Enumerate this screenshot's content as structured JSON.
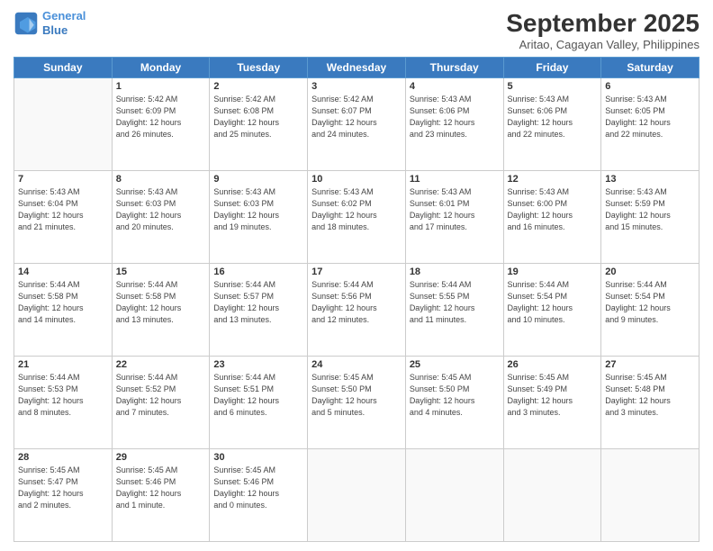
{
  "logo": {
    "line1": "General",
    "line2": "Blue"
  },
  "title": "September 2025",
  "subtitle": "Aritao, Cagayan Valley, Philippines",
  "weekdays": [
    "Sunday",
    "Monday",
    "Tuesday",
    "Wednesday",
    "Thursday",
    "Friday",
    "Saturday"
  ],
  "weeks": [
    [
      {
        "day": "",
        "info": ""
      },
      {
        "day": "1",
        "info": "Sunrise: 5:42 AM\nSunset: 6:09 PM\nDaylight: 12 hours\nand 26 minutes."
      },
      {
        "day": "2",
        "info": "Sunrise: 5:42 AM\nSunset: 6:08 PM\nDaylight: 12 hours\nand 25 minutes."
      },
      {
        "day": "3",
        "info": "Sunrise: 5:42 AM\nSunset: 6:07 PM\nDaylight: 12 hours\nand 24 minutes."
      },
      {
        "day": "4",
        "info": "Sunrise: 5:43 AM\nSunset: 6:06 PM\nDaylight: 12 hours\nand 23 minutes."
      },
      {
        "day": "5",
        "info": "Sunrise: 5:43 AM\nSunset: 6:06 PM\nDaylight: 12 hours\nand 22 minutes."
      },
      {
        "day": "6",
        "info": "Sunrise: 5:43 AM\nSunset: 6:05 PM\nDaylight: 12 hours\nand 22 minutes."
      }
    ],
    [
      {
        "day": "7",
        "info": "Sunrise: 5:43 AM\nSunset: 6:04 PM\nDaylight: 12 hours\nand 21 minutes."
      },
      {
        "day": "8",
        "info": "Sunrise: 5:43 AM\nSunset: 6:03 PM\nDaylight: 12 hours\nand 20 minutes."
      },
      {
        "day": "9",
        "info": "Sunrise: 5:43 AM\nSunset: 6:03 PM\nDaylight: 12 hours\nand 19 minutes."
      },
      {
        "day": "10",
        "info": "Sunrise: 5:43 AM\nSunset: 6:02 PM\nDaylight: 12 hours\nand 18 minutes."
      },
      {
        "day": "11",
        "info": "Sunrise: 5:43 AM\nSunset: 6:01 PM\nDaylight: 12 hours\nand 17 minutes."
      },
      {
        "day": "12",
        "info": "Sunrise: 5:43 AM\nSunset: 6:00 PM\nDaylight: 12 hours\nand 16 minutes."
      },
      {
        "day": "13",
        "info": "Sunrise: 5:43 AM\nSunset: 5:59 PM\nDaylight: 12 hours\nand 15 minutes."
      }
    ],
    [
      {
        "day": "14",
        "info": "Sunrise: 5:44 AM\nSunset: 5:58 PM\nDaylight: 12 hours\nand 14 minutes."
      },
      {
        "day": "15",
        "info": "Sunrise: 5:44 AM\nSunset: 5:58 PM\nDaylight: 12 hours\nand 13 minutes."
      },
      {
        "day": "16",
        "info": "Sunrise: 5:44 AM\nSunset: 5:57 PM\nDaylight: 12 hours\nand 13 minutes."
      },
      {
        "day": "17",
        "info": "Sunrise: 5:44 AM\nSunset: 5:56 PM\nDaylight: 12 hours\nand 12 minutes."
      },
      {
        "day": "18",
        "info": "Sunrise: 5:44 AM\nSunset: 5:55 PM\nDaylight: 12 hours\nand 11 minutes."
      },
      {
        "day": "19",
        "info": "Sunrise: 5:44 AM\nSunset: 5:54 PM\nDaylight: 12 hours\nand 10 minutes."
      },
      {
        "day": "20",
        "info": "Sunrise: 5:44 AM\nSunset: 5:54 PM\nDaylight: 12 hours\nand 9 minutes."
      }
    ],
    [
      {
        "day": "21",
        "info": "Sunrise: 5:44 AM\nSunset: 5:53 PM\nDaylight: 12 hours\nand 8 minutes."
      },
      {
        "day": "22",
        "info": "Sunrise: 5:44 AM\nSunset: 5:52 PM\nDaylight: 12 hours\nand 7 minutes."
      },
      {
        "day": "23",
        "info": "Sunrise: 5:44 AM\nSunset: 5:51 PM\nDaylight: 12 hours\nand 6 minutes."
      },
      {
        "day": "24",
        "info": "Sunrise: 5:45 AM\nSunset: 5:50 PM\nDaylight: 12 hours\nand 5 minutes."
      },
      {
        "day": "25",
        "info": "Sunrise: 5:45 AM\nSunset: 5:50 PM\nDaylight: 12 hours\nand 4 minutes."
      },
      {
        "day": "26",
        "info": "Sunrise: 5:45 AM\nSunset: 5:49 PM\nDaylight: 12 hours\nand 3 minutes."
      },
      {
        "day": "27",
        "info": "Sunrise: 5:45 AM\nSunset: 5:48 PM\nDaylight: 12 hours\nand 3 minutes."
      }
    ],
    [
      {
        "day": "28",
        "info": "Sunrise: 5:45 AM\nSunset: 5:47 PM\nDaylight: 12 hours\nand 2 minutes."
      },
      {
        "day": "29",
        "info": "Sunrise: 5:45 AM\nSunset: 5:46 PM\nDaylight: 12 hours\nand 1 minute."
      },
      {
        "day": "30",
        "info": "Sunrise: 5:45 AM\nSunset: 5:46 PM\nDaylight: 12 hours\nand 0 minutes."
      },
      {
        "day": "",
        "info": ""
      },
      {
        "day": "",
        "info": ""
      },
      {
        "day": "",
        "info": ""
      },
      {
        "day": "",
        "info": ""
      }
    ]
  ]
}
